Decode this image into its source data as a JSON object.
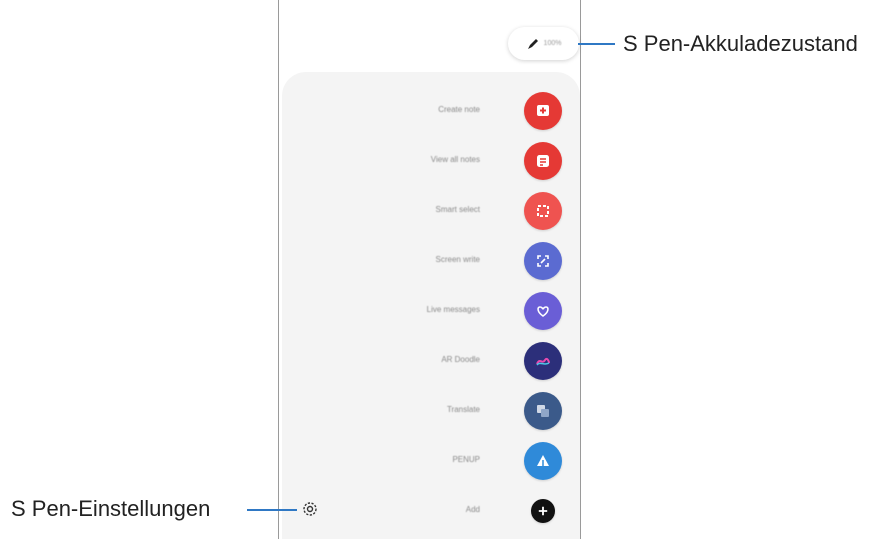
{
  "battery": {
    "percent_text": "100%"
  },
  "callouts": {
    "battery_label": "S Pen-Akkuladezustand",
    "settings_label": "S Pen-Einstellungen"
  },
  "menu": {
    "items": [
      {
        "label": "Create note",
        "icon": "create-note-icon",
        "color": "#e53935"
      },
      {
        "label": "View all notes",
        "icon": "view-notes-icon",
        "color": "#e53935"
      },
      {
        "label": "Smart select",
        "icon": "smart-select-icon",
        "color": "#ef5350"
      },
      {
        "label": "Screen write",
        "icon": "screen-write-icon",
        "color": "#5b6bd1"
      },
      {
        "label": "Live messages",
        "icon": "live-messages-icon",
        "color": "#6a5ed6"
      },
      {
        "label": "AR Doodle",
        "icon": "ar-doodle-icon",
        "color": "#2c2f7a"
      },
      {
        "label": "Translate",
        "icon": "translate-icon",
        "color": "#3b5a8a"
      },
      {
        "label": "PENUP",
        "icon": "penup-icon",
        "color": "#2f8ad9"
      },
      {
        "label": "Add",
        "icon": "add-icon",
        "color": "#111111"
      }
    ]
  }
}
